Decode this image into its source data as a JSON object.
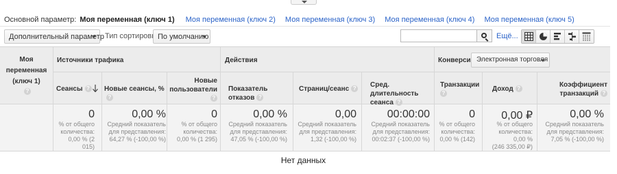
{
  "primary": {
    "label": "Основной параметр:",
    "active": "Моя переменная (ключ 1)",
    "links": [
      "Моя переменная (ключ 2)",
      "Моя переменная (ключ 3)",
      "Моя переменная (ключ 4)",
      "Моя переменная (ключ 5)"
    ]
  },
  "toolbar": {
    "secondary_dimension": "Дополнительный параметр",
    "sort_label": "Тип сортировки:",
    "sort_value": "По умолчанию",
    "search_placeholder": "",
    "more_label": "Ещё...",
    "view_icons": [
      "table-view-icon",
      "pie-view-icon",
      "performance-view-icon",
      "comparison-view-icon",
      "pivot-view-icon"
    ]
  },
  "table": {
    "dimension_header": [
      "Моя",
      "переменная",
      "(ключ 1)"
    ],
    "groups": {
      "traffic": "Источники трафика",
      "actions": "Действия",
      "conversions": "Конверсии"
    },
    "conversion_select": "Электронная торговля",
    "columns": [
      {
        "title": [
          "Сеансы"
        ],
        "value": "0",
        "sub": [
          "% от общего",
          "количества:",
          "0,00 % (2 015)"
        ]
      },
      {
        "title": [
          "Новые сеансы, %"
        ],
        "value": "0,00 %",
        "sub": [
          "Средний показатель",
          "для представления:",
          "64,27 % (-100,00 %)"
        ]
      },
      {
        "title": [
          "Новые",
          "пользователи"
        ],
        "value": "0",
        "sub": [
          "% от общего",
          "количества:",
          "0,00 % (1 295)"
        ]
      },
      {
        "title": [
          "Показатель отказов"
        ],
        "value": "0,00 %",
        "sub": [
          "Средний показатель",
          "для представления:",
          "47,05 % (-100,00 %)"
        ]
      },
      {
        "title": [
          "Страниц/сеанс"
        ],
        "value": "0,00",
        "sub": [
          "Средний показатель",
          "для представления:",
          "1,32 (-100,00 %)"
        ]
      },
      {
        "title": [
          "Сред. длительность",
          "сеанса"
        ],
        "value": "00:00:00",
        "sub": [
          "Средний показатель",
          "для представления:",
          "00:02:37 (-100,00 %)"
        ]
      },
      {
        "title": [
          "Транзакции"
        ],
        "value": "0",
        "sub": [
          "% от общего",
          "количества:",
          "0,00 % (142)"
        ]
      },
      {
        "title": [
          "Доход"
        ],
        "value": "0,00 ₽",
        "sub": [
          "% от общего",
          "количества:",
          "0,00 %",
          "(246 335,00 ₽)"
        ]
      },
      {
        "title": [
          "Коэффициент",
          "транзакций"
        ],
        "value": "0,00 %",
        "sub": [
          "Средний показатель",
          "для представления:",
          "7,05 % (-100,00 %)"
        ]
      }
    ],
    "empty_message": "Нет данных"
  }
}
